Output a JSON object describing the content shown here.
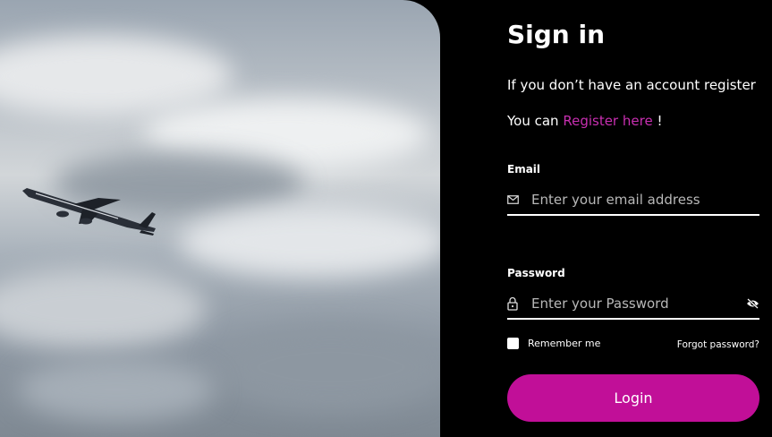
{
  "photo": {
    "subject": "airplane-in-cloudy-sky"
  },
  "form": {
    "title": "Sign in",
    "intro": "If you don’t have an account register",
    "register_prefix": "You can ",
    "register_link": "Register here",
    "register_suffix": " !",
    "email": {
      "label": "Email",
      "placeholder": "Enter your email address",
      "value": "",
      "icon": "envelope-icon"
    },
    "password": {
      "label": "Password",
      "placeholder": "Enter your Password",
      "value": "",
      "icon": "lock-icon",
      "toggle_icon": "eye-slash-icon"
    },
    "remember_label": "Remember me",
    "remember_checked": false,
    "forgot_label": "Forgot password?",
    "login_label": "Login"
  },
  "colors": {
    "accent": "#c10f98",
    "link": "#c72fb0",
    "background": "#000000"
  }
}
